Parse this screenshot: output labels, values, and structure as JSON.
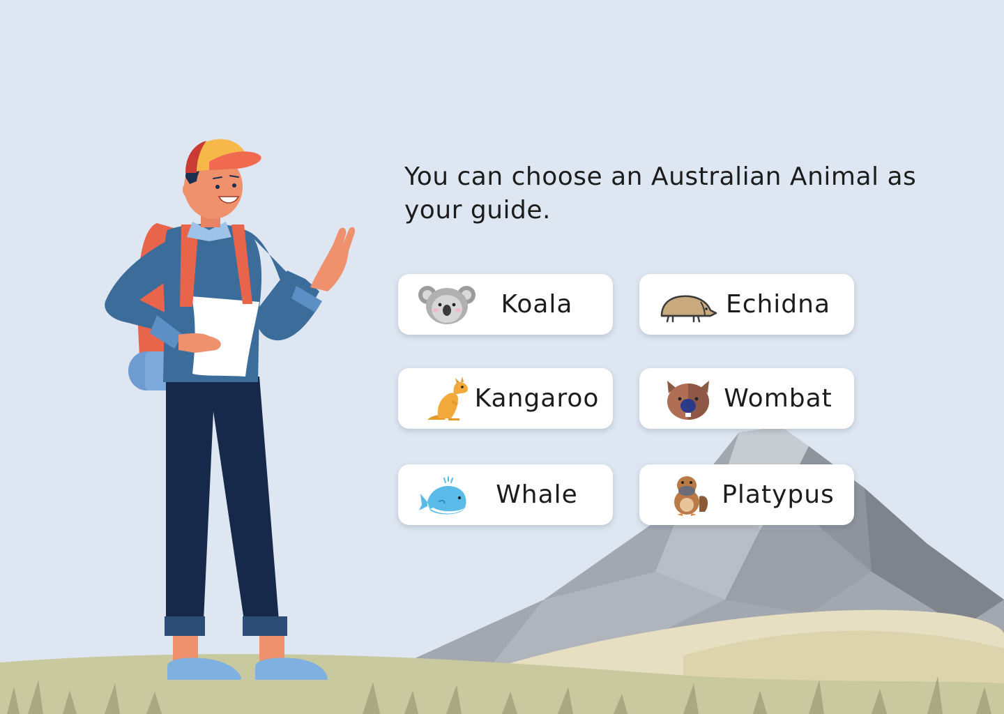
{
  "prompt": {
    "text": "You can choose an Australian Animal as your guide."
  },
  "options": [
    {
      "label": "Koala",
      "icon": "koala-icon"
    },
    {
      "label": "Echidna",
      "icon": "echidna-icon"
    },
    {
      "label": "Kangaroo",
      "icon": "kangaroo-icon"
    },
    {
      "label": "Wombat",
      "icon": "wombat-icon"
    },
    {
      "label": "Whale",
      "icon": "whale-icon"
    },
    {
      "label": "Platypus",
      "icon": "platypus-icon"
    }
  ],
  "colors": {
    "sky": "#dde6f1",
    "mountain": "#9ea4ad",
    "hill": "#e6dcb8",
    "grass": "#c6c69a",
    "card": "#ffffff",
    "text": "#1c1c1c"
  }
}
